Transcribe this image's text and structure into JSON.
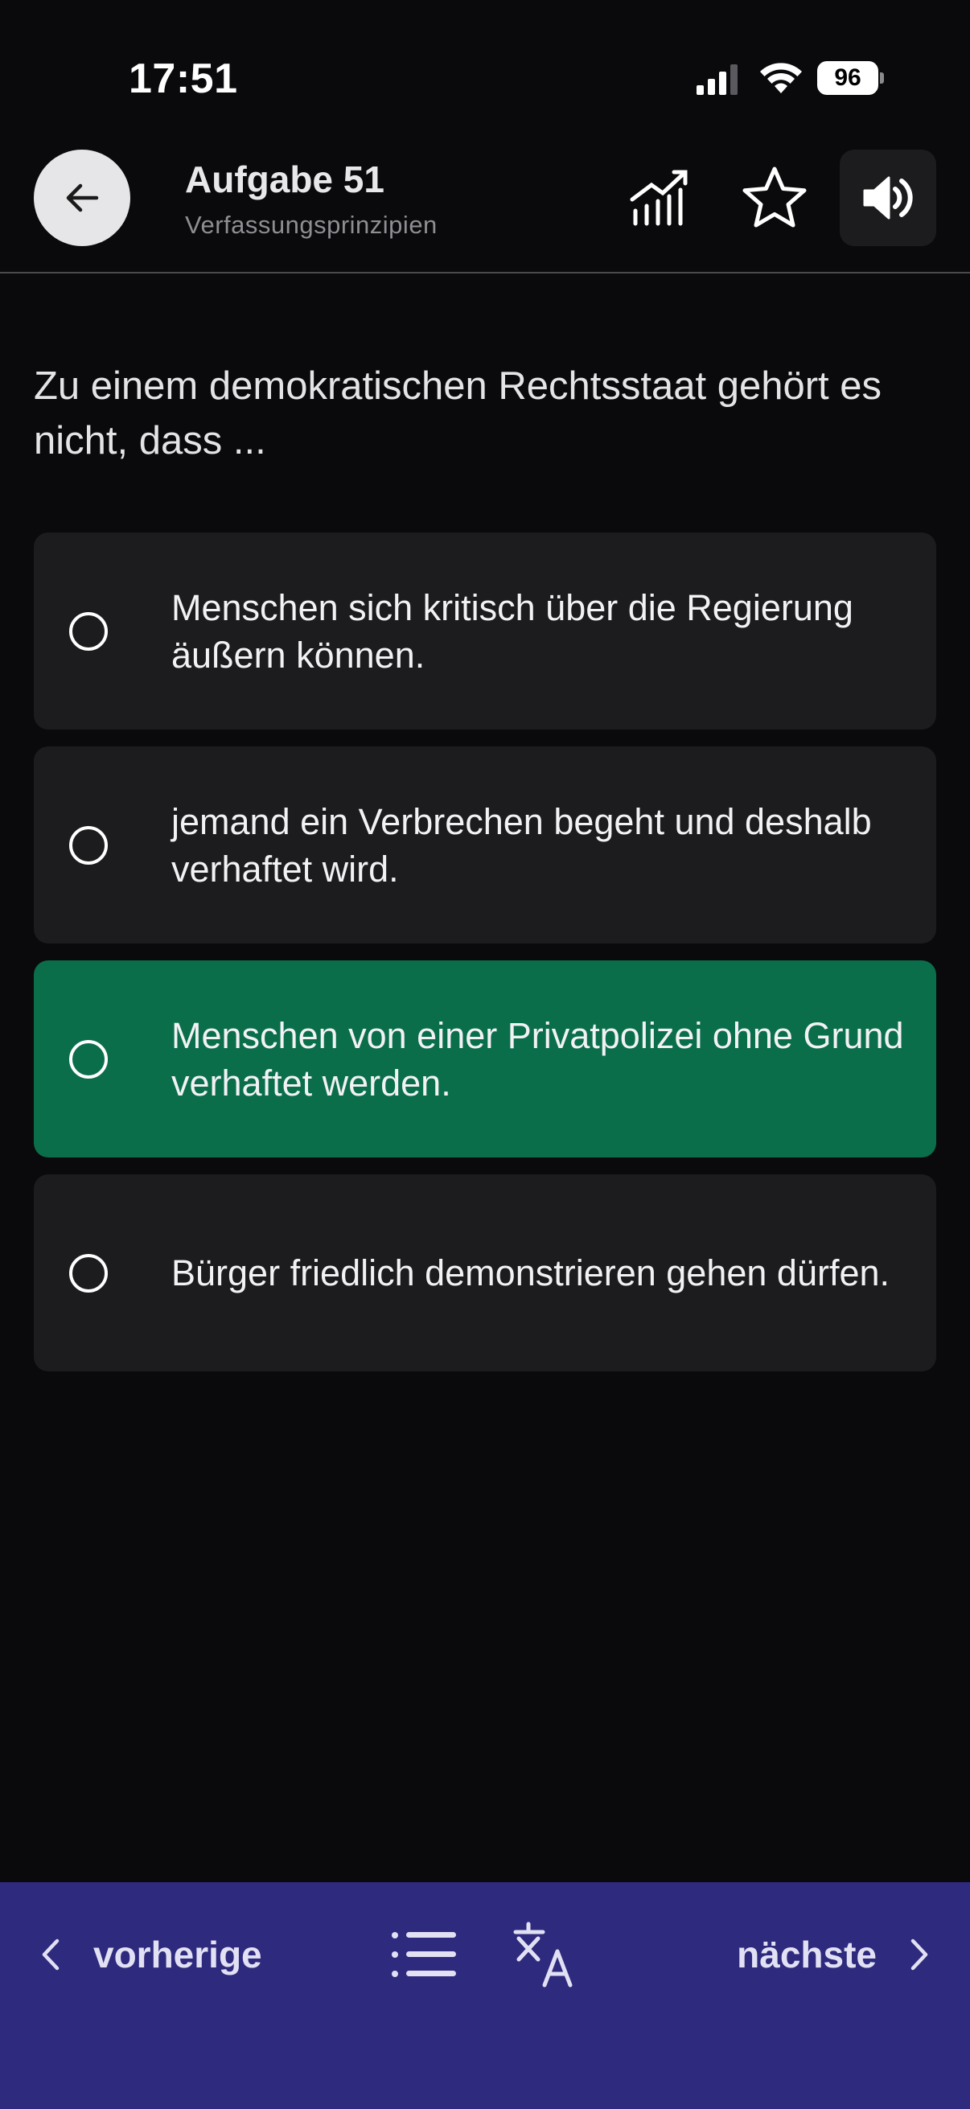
{
  "status_bar": {
    "time": "17:51",
    "battery": "96"
  },
  "header": {
    "title": "Aufgabe 51",
    "subtitle": "Verfassungsprinzipien"
  },
  "icons": {
    "back": "arrow-left-icon",
    "stats": "chart-icon",
    "favorite": "star-icon",
    "sound": "speaker-icon",
    "list": "list-icon",
    "translate": "translate-icon",
    "prev": "chevron-left-icon",
    "next": "chevron-right-icon"
  },
  "question": {
    "text": "Zu einem demokratischen Rechtsstaat gehört es nicht, dass ..."
  },
  "answers": [
    {
      "text": "Menschen sich kritisch über die Regierung äußern können.",
      "state": "default"
    },
    {
      "text": "jemand ein Verbrechen begeht und deshalb verhaftet wird.",
      "state": "default"
    },
    {
      "text": "Menschen von einer Privatpolizei ohne Grund verhaftet werden.",
      "state": "correct"
    },
    {
      "text": "Bürger friedlich demonstrieren gehen dürfen.",
      "state": "default"
    }
  ],
  "bottom_nav": {
    "prev_label": "vorherige",
    "next_label": "nächste"
  },
  "colors": {
    "background": "#0a0a0c",
    "answer_default": "#1c1c1f",
    "answer_correct": "#0a6e4b",
    "bottom_bar": "#2e2a7d"
  }
}
